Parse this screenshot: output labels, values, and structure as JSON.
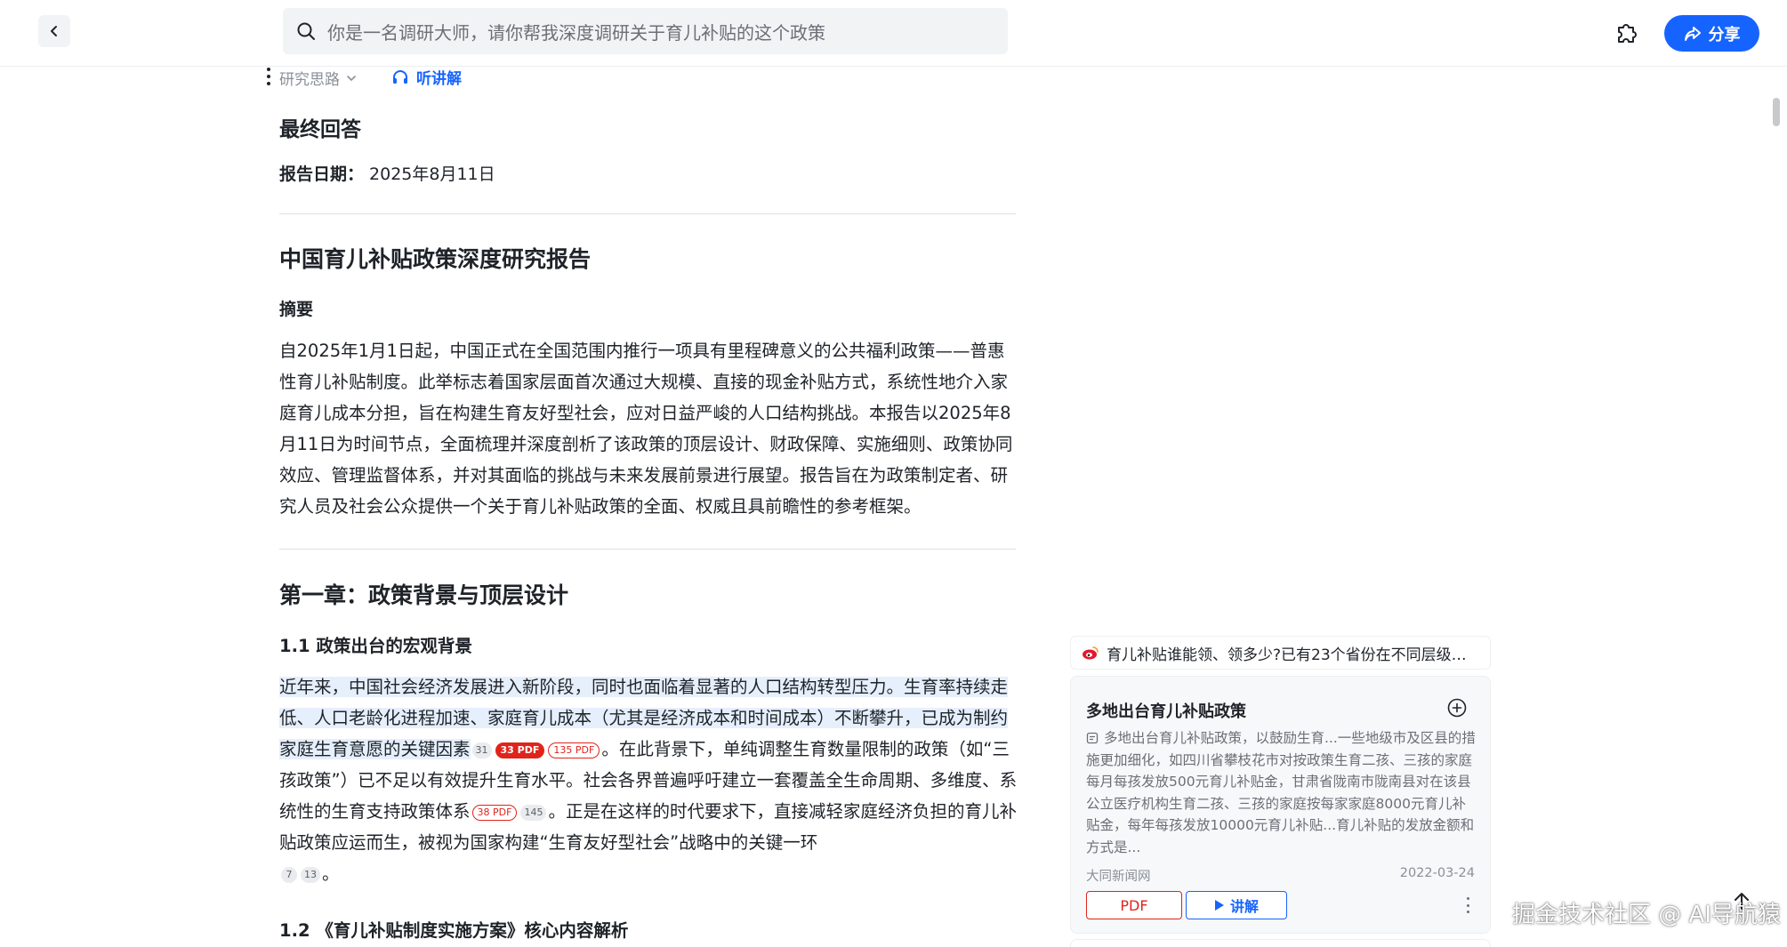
{
  "topbar": {
    "search_query": "你是一名调研大师，请你帮我深度调研关于育儿补贴的这个政策",
    "share_label": "分享",
    "back_icon": "chevron-left-icon",
    "search_icon": "search-icon",
    "plugin_icon": "puzzle-icon",
    "share_icon": "share-icon"
  },
  "toolbar": {
    "thinking_label": "研究思路",
    "listen_label": "听讲解"
  },
  "article": {
    "final_answer": "最终回答",
    "report_date_label": "报告日期：",
    "report_date_value": "2025年8月11日",
    "title": "中国育儿补贴政策深度研究报告",
    "abstract_heading": "摘要",
    "abstract_text": "自2025年1月1日起，中国正式在全国范围内推行一项具有里程碑意义的公共福利政策——普惠性育儿补贴制度。此举标志着国家层面首次通过大规模、直接的现金补贴方式，系统性地介入家庭育儿成本分担，旨在构建生育友好型社会，应对日益严峻的人口结构挑战。本报告以2025年8月11日为时间节点，全面梳理并深度剖析了该政策的顶层设计、财政保障、实施细则、政策协同效应、管理监督体系，并对其面临的挑战与未来发展前景进行展望。报告旨在为政策制定者、研究人员及社会公众提供一个关于育儿补贴政策的全面、权威且具前瞻性的参考框架。",
    "chapter1": "第一章：政策背景与顶层设计",
    "sec_1_1": "1.1 政策出台的宏观背景",
    "p1_highlight": "近年来，中国社会经济发展进入新阶段，同时也面临着显著的人口结构转型压力。生育率持续走低、人口老龄化进程加速、家庭育儿成本（尤其是经济成本和时间成本）不断攀升，已成为制约家庭生育意愿的关键因素",
    "p1_cite_a": "31",
    "p1_pdf_a": "33 PDF",
    "p1_pdf_b": "135 PDF",
    "p1_mid": "。在此背景下，单纯调整生育数量限制的政策（如“三孩政策”）已不足以有效提升生育水平。社会各界普遍呼吁建立一套覆盖全生命周期、多维度、系统性的生育支持政策体系",
    "p1_pdf_c": "38 PDF",
    "p1_cite_b": "145",
    "p1_tail": "。正是在这样的时代要求下，直接减轻家庭经济负担的育儿补贴政策应运而生，被视为国家构建“生育友好型社会”战略中的关键一环",
    "p1_cite_c": "7",
    "p1_cite_d": "13",
    "p1_end": "。",
    "sec_1_2": "1.2 《育儿补贴制度实施方案》核心内容解析"
  },
  "source_panel": {
    "source_title": "育儿补贴谁能领、领多少?已有23个省份在不同层级…",
    "source_icon": "weibo-icon",
    "card_title": "多地出台育儿补贴政策",
    "card_desc": "多地出台育儿补贴政策，以鼓励生育...一些地级市及区县的措施更加细化，如四川省攀枝花市对按政策生育二孩、三孩的家庭每月每孩发放500元育儿补贴金，甘肃省陇南市陇南县对在该县公立医疗机构生育二孩、三孩的家庭按每家家庭8000元育儿补贴金，每年每孩发放10000元育儿补贴...育儿补贴的发放金额和方式是...",
    "card_source": "大同新闻网",
    "card_date": "2022-03-24",
    "btn_pdf": "PDF",
    "btn_explain": "讲解"
  },
  "watermark": "掘金技术社区 @ AI导航猿",
  "colors": {
    "accent": "#1664ff",
    "pdf_red": "#e0241b",
    "highlight": "#e6effc"
  }
}
